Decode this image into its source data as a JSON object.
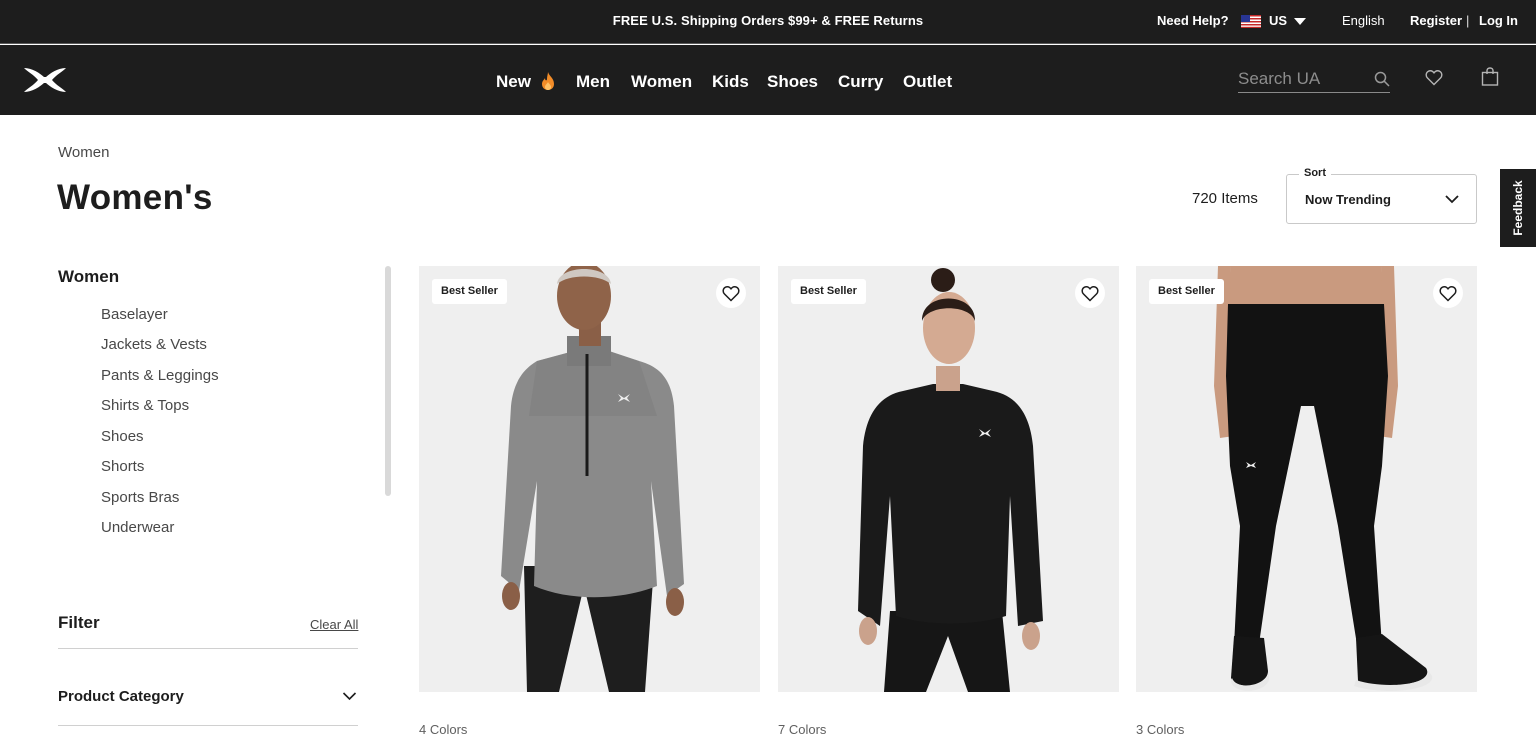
{
  "promo": {
    "text": "FREE U.S. Shipping Orders $99+ & FREE Returns"
  },
  "utility": {
    "need_help": "Need Help?",
    "country": "US",
    "language": "English",
    "register": "Register",
    "divider": "|",
    "login": "Log In"
  },
  "nav": {
    "items": [
      {
        "label": "New"
      },
      {
        "label": "Men"
      },
      {
        "label": "Women"
      },
      {
        "label": "Kids"
      },
      {
        "label": "Shoes"
      },
      {
        "label": "Curry"
      },
      {
        "label": "Outlet"
      }
    ],
    "search_placeholder": "Search UA"
  },
  "page": {
    "breadcrumb": "Women",
    "title": "Women's",
    "item_count": "720 Items",
    "sort_label": "Sort",
    "sort_value": "Now Trending",
    "feedback": "Feedback"
  },
  "sidebar": {
    "heading": "Women",
    "items": [
      {
        "label": "Baselayer"
      },
      {
        "label": "Jackets & Vests"
      },
      {
        "label": "Pants & Leggings"
      },
      {
        "label": "Shirts & Tops"
      },
      {
        "label": "Shoes"
      },
      {
        "label": "Shorts"
      },
      {
        "label": "Sports Bras"
      },
      {
        "label": "Underwear"
      }
    ],
    "filter_title": "Filter",
    "clear_all": "Clear All",
    "product_category": "Product Category"
  },
  "products": [
    {
      "badge": "Best Seller",
      "colors": "4 Colors"
    },
    {
      "badge": "Best Seller",
      "colors": "7 Colors"
    },
    {
      "badge": "Best Seller",
      "colors": "3 Colors"
    }
  ],
  "icons": {
    "logo": "under-armour-logo",
    "flag": "us-flag-icon",
    "new_badge": "flame-icon",
    "search": "search-icon",
    "wishlist": "heart-icon",
    "bag": "shopping-bag-icon",
    "chevron": "chevron-down-icon"
  },
  "colors": {
    "header_bg": "#1d1d1d",
    "flame": "#f28c28",
    "card_bg": "#f0f0f0"
  }
}
